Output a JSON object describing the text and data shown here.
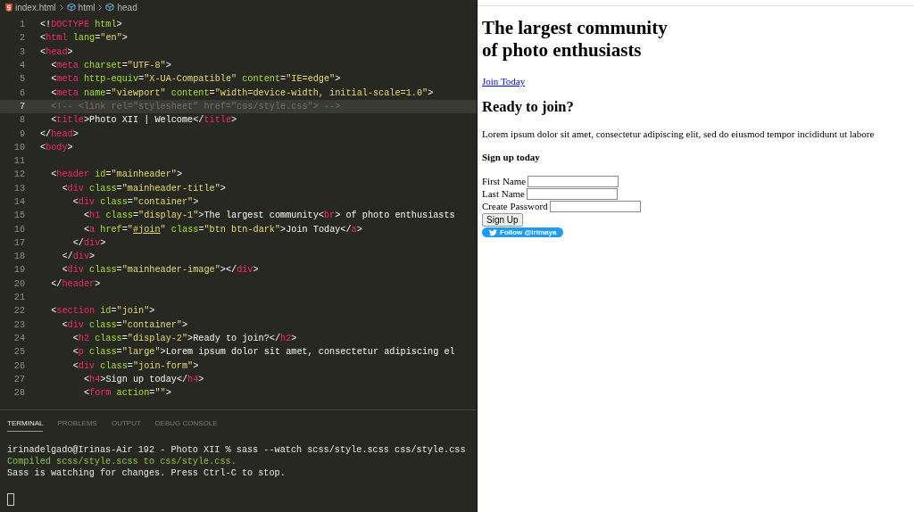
{
  "editor": {
    "breadcrumbs": [
      {
        "label": "index.html",
        "kind": "file"
      },
      {
        "label": "html",
        "kind": "symbol"
      },
      {
        "label": "head",
        "kind": "symbol"
      }
    ],
    "lines": [
      {
        "number": "1",
        "current": false,
        "tokens": [
          {
            "kind": "p",
            "text": "<!"
          },
          {
            "kind": "tag",
            "text": "DOCTYPE"
          },
          {
            "kind": "attr",
            "text": " html"
          },
          {
            "kind": "p",
            "text": ">"
          }
        ]
      },
      {
        "number": "2",
        "current": false,
        "tokens": [
          {
            "kind": "p",
            "text": "<"
          },
          {
            "kind": "tag",
            "text": "html"
          },
          {
            "kind": "attr",
            "text": " lang"
          },
          {
            "kind": "p",
            "text": "="
          },
          {
            "kind": "str",
            "text": "\"en\""
          },
          {
            "kind": "p",
            "text": ">"
          }
        ]
      },
      {
        "number": "3",
        "current": false,
        "tokens": [
          {
            "kind": "p",
            "text": "<"
          },
          {
            "kind": "tag",
            "text": "head"
          },
          {
            "kind": "p",
            "text": ">"
          }
        ]
      },
      {
        "number": "4",
        "current": false,
        "tokens": [
          {
            "kind": "p",
            "text": "  <"
          },
          {
            "kind": "tag",
            "text": "meta"
          },
          {
            "kind": "attr",
            "text": " charset"
          },
          {
            "kind": "p",
            "text": "="
          },
          {
            "kind": "str",
            "text": "\"UTF-8\""
          },
          {
            "kind": "p",
            "text": ">"
          }
        ]
      },
      {
        "number": "5",
        "current": false,
        "tokens": [
          {
            "kind": "p",
            "text": "  <"
          },
          {
            "kind": "tag",
            "text": "meta"
          },
          {
            "kind": "attr",
            "text": " http-equiv"
          },
          {
            "kind": "p",
            "text": "="
          },
          {
            "kind": "str",
            "text": "\"X-UA-Compatible\""
          },
          {
            "kind": "attr",
            "text": " content"
          },
          {
            "kind": "p",
            "text": "="
          },
          {
            "kind": "str",
            "text": "\"IE=edge\""
          },
          {
            "kind": "p",
            "text": ">"
          }
        ]
      },
      {
        "number": "6",
        "current": false,
        "tokens": [
          {
            "kind": "p",
            "text": "  <"
          },
          {
            "kind": "tag",
            "text": "meta"
          },
          {
            "kind": "attr",
            "text": " name"
          },
          {
            "kind": "p",
            "text": "="
          },
          {
            "kind": "str",
            "text": "\"viewport\""
          },
          {
            "kind": "attr",
            "text": " content"
          },
          {
            "kind": "p",
            "text": "="
          },
          {
            "kind": "str",
            "text": "\"width=device-width, initial-scale=1.0\""
          },
          {
            "kind": "p",
            "text": ">"
          }
        ]
      },
      {
        "number": "7",
        "current": true,
        "tokens": [
          {
            "kind": "comment",
            "text": "  <!-- <link rel=\"stylesheet\" href=\"css/style.css\"> -->"
          }
        ]
      },
      {
        "number": "8",
        "current": false,
        "tokens": [
          {
            "kind": "p",
            "text": "  <"
          },
          {
            "kind": "tag",
            "text": "title"
          },
          {
            "kind": "p",
            "text": ">"
          },
          {
            "kind": "text",
            "text": "Photo XII | Welcome"
          },
          {
            "kind": "p",
            "text": "</"
          },
          {
            "kind": "tag",
            "text": "title"
          },
          {
            "kind": "p",
            "text": ">"
          }
        ]
      },
      {
        "number": "9",
        "current": false,
        "tokens": [
          {
            "kind": "p",
            "text": "</"
          },
          {
            "kind": "tag",
            "text": "head"
          },
          {
            "kind": "p",
            "text": ">"
          }
        ]
      },
      {
        "number": "10",
        "current": false,
        "tokens": [
          {
            "kind": "p",
            "text": "<"
          },
          {
            "kind": "tag",
            "text": "body"
          },
          {
            "kind": "p",
            "text": ">"
          }
        ]
      },
      {
        "number": "11",
        "current": false
      },
      {
        "number": "12",
        "current": false,
        "tokens": [
          {
            "kind": "p",
            "text": "  <"
          },
          {
            "kind": "tag",
            "text": "header"
          },
          {
            "kind": "attr",
            "text": " id"
          },
          {
            "kind": "p",
            "text": "="
          },
          {
            "kind": "str",
            "text": "\"mainheader\""
          },
          {
            "kind": "p",
            "text": ">"
          }
        ]
      },
      {
        "number": "13",
        "current": false,
        "tokens": [
          {
            "kind": "p",
            "text": "    <"
          },
          {
            "kind": "tag",
            "text": "div"
          },
          {
            "kind": "attr",
            "text": " class"
          },
          {
            "kind": "p",
            "text": "="
          },
          {
            "kind": "str",
            "text": "\"mainheader-title\""
          },
          {
            "kind": "p",
            "text": ">"
          }
        ]
      },
      {
        "number": "14",
        "current": false,
        "tokens": [
          {
            "kind": "p",
            "text": "      <"
          },
          {
            "kind": "tag",
            "text": "div"
          },
          {
            "kind": "attr",
            "text": " class"
          },
          {
            "kind": "p",
            "text": "="
          },
          {
            "kind": "str",
            "text": "\"container\""
          },
          {
            "kind": "p",
            "text": ">"
          }
        ]
      },
      {
        "number": "15",
        "current": false,
        "tokens": [
          {
            "kind": "p",
            "text": "        <"
          },
          {
            "kind": "tag",
            "text": "h1"
          },
          {
            "kind": "attr",
            "text": " class"
          },
          {
            "kind": "p",
            "text": "="
          },
          {
            "kind": "str",
            "text": "\"display-1\""
          },
          {
            "kind": "p",
            "text": ">"
          },
          {
            "kind": "text",
            "text": "The largest community"
          },
          {
            "kind": "p",
            "text": "<"
          },
          {
            "kind": "tag",
            "text": "br"
          },
          {
            "kind": "p",
            "text": ">"
          },
          {
            "kind": "text",
            "text": " of photo enthusiasts"
          }
        ]
      },
      {
        "number": "16",
        "current": false,
        "tokens": [
          {
            "kind": "p",
            "text": "        <"
          },
          {
            "kind": "tag",
            "text": "a"
          },
          {
            "kind": "attr",
            "text": " href"
          },
          {
            "kind": "p",
            "text": "="
          },
          {
            "kind": "str",
            "text": "\""
          },
          {
            "kind": "link",
            "text": "#join"
          },
          {
            "kind": "str",
            "text": "\""
          },
          {
            "kind": "attr",
            "text": " class"
          },
          {
            "kind": "p",
            "text": "="
          },
          {
            "kind": "str",
            "text": "\"btn btn-dark\""
          },
          {
            "kind": "p",
            "text": ">"
          },
          {
            "kind": "text",
            "text": "Join Today"
          },
          {
            "kind": "p",
            "text": "</"
          },
          {
            "kind": "tag",
            "text": "a"
          },
          {
            "kind": "p",
            "text": ">"
          }
        ]
      },
      {
        "number": "17",
        "current": false,
        "tokens": [
          {
            "kind": "p",
            "text": "      </"
          },
          {
            "kind": "tag",
            "text": "div"
          },
          {
            "kind": "p",
            "text": ">"
          }
        ]
      },
      {
        "number": "18",
        "current": false,
        "tokens": [
          {
            "kind": "p",
            "text": "    </"
          },
          {
            "kind": "tag",
            "text": "div"
          },
          {
            "kind": "p",
            "text": ">"
          }
        ]
      },
      {
        "number": "19",
        "current": false,
        "tokens": [
          {
            "kind": "p",
            "text": "    <"
          },
          {
            "kind": "tag",
            "text": "div"
          },
          {
            "kind": "attr",
            "text": " class"
          },
          {
            "kind": "p",
            "text": "="
          },
          {
            "kind": "str",
            "text": "\"mainheader-image\""
          },
          {
            "kind": "p",
            "text": "></"
          },
          {
            "kind": "tag",
            "text": "div"
          },
          {
            "kind": "p",
            "text": ">"
          }
        ]
      },
      {
        "number": "20",
        "current": false,
        "tokens": [
          {
            "kind": "p",
            "text": "  </"
          },
          {
            "kind": "tag",
            "text": "header"
          },
          {
            "kind": "p",
            "text": ">"
          }
        ]
      },
      {
        "number": "21",
        "current": false
      },
      {
        "number": "22",
        "current": false,
        "tokens": [
          {
            "kind": "p",
            "text": "  <"
          },
          {
            "kind": "tag",
            "text": "section"
          },
          {
            "kind": "attr",
            "text": " id"
          },
          {
            "kind": "p",
            "text": "="
          },
          {
            "kind": "str",
            "text": "\"join\""
          },
          {
            "kind": "p",
            "text": ">"
          }
        ]
      },
      {
        "number": "23",
        "current": false,
        "tokens": [
          {
            "kind": "p",
            "text": "    <"
          },
          {
            "kind": "tag",
            "text": "div"
          },
          {
            "kind": "attr",
            "text": " class"
          },
          {
            "kind": "p",
            "text": "="
          },
          {
            "kind": "str",
            "text": "\"container\""
          },
          {
            "kind": "p",
            "text": ">"
          }
        ]
      },
      {
        "number": "24",
        "current": false,
        "tokens": [
          {
            "kind": "p",
            "text": "      <"
          },
          {
            "kind": "tag",
            "text": "h2"
          },
          {
            "kind": "attr",
            "text": " class"
          },
          {
            "kind": "p",
            "text": "="
          },
          {
            "kind": "str",
            "text": "\"display-2\""
          },
          {
            "kind": "p",
            "text": ">"
          },
          {
            "kind": "text",
            "text": "Ready to join?"
          },
          {
            "kind": "p",
            "text": "</"
          },
          {
            "kind": "tag",
            "text": "h2"
          },
          {
            "kind": "p",
            "text": ">"
          }
        ]
      },
      {
        "number": "25",
        "current": false,
        "tokens": [
          {
            "kind": "p",
            "text": "      <"
          },
          {
            "kind": "tag",
            "text": "p"
          },
          {
            "kind": "attr",
            "text": " class"
          },
          {
            "kind": "p",
            "text": "="
          },
          {
            "kind": "str",
            "text": "\"large\""
          },
          {
            "kind": "p",
            "text": ">"
          },
          {
            "kind": "text",
            "text": "Lorem ipsum dolor sit amet, consectetur adipiscing el"
          }
        ]
      },
      {
        "number": "26",
        "current": false,
        "tokens": [
          {
            "kind": "p",
            "text": "      <"
          },
          {
            "kind": "tag",
            "text": "div"
          },
          {
            "kind": "attr",
            "text": " class"
          },
          {
            "kind": "p",
            "text": "="
          },
          {
            "kind": "str",
            "text": "\"join-form\""
          },
          {
            "kind": "p",
            "text": ">"
          }
        ]
      },
      {
        "number": "27",
        "current": false,
        "tokens": [
          {
            "kind": "p",
            "text": "        <"
          },
          {
            "kind": "tag",
            "text": "h4"
          },
          {
            "kind": "p",
            "text": ">"
          },
          {
            "kind": "text",
            "text": "Sign up today"
          },
          {
            "kind": "p",
            "text": "</"
          },
          {
            "kind": "tag",
            "text": "h4"
          },
          {
            "kind": "p",
            "text": ">"
          }
        ]
      },
      {
        "number": "28",
        "current": false,
        "tokens": [
          {
            "kind": "p",
            "text": "        <"
          },
          {
            "kind": "tag",
            "text": "form"
          },
          {
            "kind": "attr",
            "text": " action"
          },
          {
            "kind": "p",
            "text": "="
          },
          {
            "kind": "str",
            "text": "\"\""
          },
          {
            "kind": "p",
            "text": ">"
          }
        ]
      }
    ]
  },
  "panel": {
    "tabs": [
      {
        "label": "TERMINAL",
        "selected": true
      },
      {
        "label": "PROBLEMS",
        "selected": false
      },
      {
        "label": "OUTPUT",
        "selected": false
      },
      {
        "label": "DEBUG CONSOLE",
        "selected": false
      }
    ],
    "terminal_lines": [
      {
        "kind": "plain",
        "text": "irinadelgado@Irinas-Air 192 - Photo XII % sass --watch scss/style.scss css/style.css"
      },
      {
        "kind": "success",
        "text": "Compiled scss/style.scss to css/style.css."
      },
      {
        "kind": "plain",
        "text": "Sass is watching for changes. Press Ctrl-C to stop."
      }
    ]
  },
  "preview": {
    "heading": [
      "The largest community",
      "of photo enthusiasts"
    ],
    "link": "Join Today",
    "subheading": "Ready to join?",
    "paragraph": "Lorem ipsum dolor sit amet, consectetur adipiscing elit, sed do eiusmod tempor incididunt ut labore",
    "form_title": "Sign up today",
    "fields": [
      {
        "label": "First Name"
      },
      {
        "label": "Last Name"
      },
      {
        "label": "Create Password"
      }
    ],
    "submit": "Sign Up",
    "follow_button": "Follow @irimaya"
  }
}
